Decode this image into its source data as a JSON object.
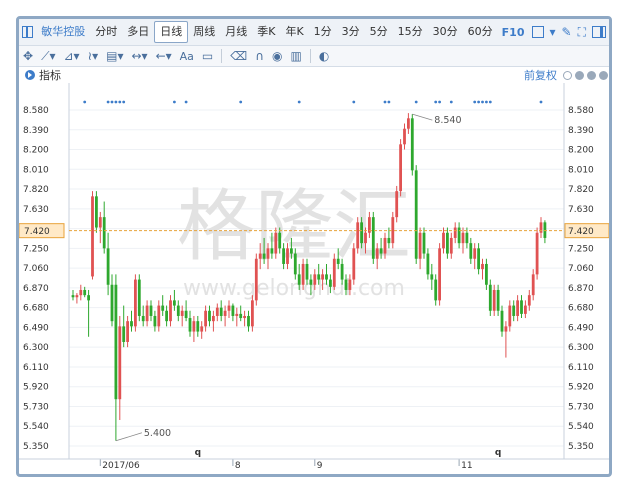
{
  "toolbar": {
    "stock_name": "敏华控股",
    "periods": [
      "分时",
      "多日",
      "日线",
      "周线",
      "月线",
      "季K",
      "年K",
      "1分",
      "3分",
      "5分",
      "15分",
      "30分",
      "60分"
    ],
    "active_period": "日线",
    "f10": "F10"
  },
  "drawbar": {
    "text_tool": "Aa"
  },
  "indicator_bar": {
    "label": "指标",
    "adjust": "前复权"
  },
  "watermark": {
    "cn": "格隆汇",
    "url": "www.gelonghui.com"
  },
  "chart_data": {
    "type": "candlestick",
    "y_ticks": [
      "8.580",
      "8.390",
      "8.200",
      "8.010",
      "7.820",
      "7.630",
      "7.420",
      "7.250",
      "7.060",
      "6.870",
      "6.680",
      "6.490",
      "6.300",
      "6.110",
      "5.920",
      "5.730",
      "5.540",
      "5.350"
    ],
    "ylim": [
      5.35,
      8.58
    ],
    "current_price": "7.420",
    "x_labels": [
      {
        "label": "2017/06",
        "index": 7
      },
      {
        "label": "8",
        "index": 41
      },
      {
        "label": "9",
        "index": 62
      },
      {
        "label": "11",
        "index": 99
      }
    ],
    "annotations": [
      {
        "text": "8.540",
        "index": 87,
        "value": 8.54,
        "kind": "high"
      },
      {
        "text": "5.400",
        "index": 11,
        "value": 5.4,
        "kind": "low"
      }
    ],
    "event_markers": [
      {
        "text": "q",
        "index": 32
      },
      {
        "text": "q",
        "index": 109
      }
    ],
    "dots": [
      3,
      9,
      10,
      11,
      12,
      13,
      26,
      29,
      43,
      58,
      72,
      80,
      81,
      88,
      93,
      94,
      97,
      103,
      104,
      105,
      106,
      107,
      120
    ],
    "colors": {
      "up": "#e05252",
      "down": "#2ea82e",
      "price_line": "#e8a23a"
    },
    "candles": [
      [
        6.8,
        6.85,
        6.75,
        6.78
      ],
      [
        6.78,
        6.82,
        6.72,
        6.8
      ],
      [
        6.8,
        6.9,
        6.75,
        6.85
      ],
      [
        6.85,
        6.88,
        6.78,
        6.8
      ],
      [
        6.8,
        6.85,
        6.4,
        6.75
      ],
      [
        6.98,
        7.8,
        6.95,
        7.75
      ],
      [
        7.75,
        7.8,
        7.4,
        7.45
      ],
      [
        7.45,
        7.6,
        7.3,
        7.55
      ],
      [
        7.55,
        7.7,
        7.2,
        7.25
      ],
      [
        7.25,
        7.4,
        6.8,
        6.9
      ],
      [
        6.9,
        7.0,
        6.5,
        6.55
      ],
      [
        6.9,
        7.0,
        5.4,
        5.8
      ],
      [
        5.8,
        6.6,
        5.6,
        6.5
      ],
      [
        6.5,
        6.7,
        6.3,
        6.35
      ],
      [
        6.35,
        6.6,
        6.3,
        6.55
      ],
      [
        6.55,
        6.65,
        6.45,
        6.5
      ],
      [
        6.5,
        7.0,
        6.45,
        6.95
      ],
      [
        6.95,
        7.0,
        6.55,
        6.6
      ],
      [
        6.6,
        6.7,
        6.5,
        6.55
      ],
      [
        6.55,
        6.75,
        6.5,
        6.7
      ],
      [
        6.7,
        6.75,
        6.55,
        6.6
      ],
      [
        6.6,
        6.65,
        6.45,
        6.5
      ],
      [
        6.5,
        6.75,
        6.45,
        6.7
      ],
      [
        6.7,
        6.8,
        6.6,
        6.65
      ],
      [
        6.65,
        6.7,
        6.5,
        6.55
      ],
      [
        6.55,
        6.8,
        6.5,
        6.75
      ],
      [
        6.75,
        6.85,
        6.65,
        6.7
      ],
      [
        6.7,
        6.75,
        6.55,
        6.6
      ],
      [
        6.6,
        6.7,
        6.5,
        6.65
      ],
      [
        6.65,
        6.75,
        6.55,
        6.58
      ],
      [
        6.58,
        6.65,
        6.4,
        6.45
      ],
      [
        6.45,
        6.6,
        6.35,
        6.55
      ],
      [
        6.55,
        6.6,
        6.4,
        6.45
      ],
      [
        6.45,
        6.55,
        6.38,
        6.5
      ],
      [
        6.5,
        6.7,
        6.45,
        6.65
      ],
      [
        6.65,
        6.7,
        6.5,
        6.55
      ],
      [
        6.55,
        6.65,
        6.45,
        6.6
      ],
      [
        6.6,
        6.72,
        6.55,
        6.68
      ],
      [
        6.68,
        6.75,
        6.55,
        6.6
      ],
      [
        6.6,
        6.7,
        6.5,
        6.65
      ],
      [
        6.65,
        6.75,
        6.58,
        6.7
      ],
      [
        6.7,
        6.72,
        6.55,
        6.6
      ],
      [
        6.6,
        6.68,
        6.5,
        6.62
      ],
      [
        6.62,
        6.7,
        6.55,
        6.58
      ],
      [
        6.58,
        6.65,
        6.5,
        6.6
      ],
      [
        6.6,
        6.65,
        6.45,
        6.5
      ],
      [
        6.5,
        6.8,
        6.45,
        6.75
      ],
      [
        6.75,
        7.2,
        6.7,
        7.15
      ],
      [
        7.15,
        7.3,
        7.05,
        7.2
      ],
      [
        7.2,
        7.35,
        7.1,
        7.15
      ],
      [
        7.15,
        7.3,
        7.05,
        7.25
      ],
      [
        7.25,
        7.4,
        7.15,
        7.2
      ],
      [
        7.2,
        7.45,
        7.15,
        7.4
      ],
      [
        7.4,
        7.45,
        7.2,
        7.25
      ],
      [
        7.25,
        7.3,
        7.05,
        7.1
      ],
      [
        7.1,
        7.3,
        7.05,
        7.25
      ],
      [
        7.25,
        7.35,
        7.15,
        7.2
      ],
      [
        7.2,
        7.25,
        6.95,
        7.0
      ],
      [
        7.0,
        7.1,
        6.85,
        6.9
      ],
      [
        6.9,
        7.15,
        6.85,
        7.1
      ],
      [
        7.1,
        7.15,
        6.9,
        6.95
      ],
      [
        6.95,
        7.0,
        6.8,
        6.9
      ],
      [
        6.9,
        7.05,
        6.85,
        7.0
      ],
      [
        7.0,
        7.1,
        6.9,
        6.95
      ],
      [
        6.95,
        7.05,
        6.85,
        7.0
      ],
      [
        7.0,
        7.1,
        6.9,
        6.95
      ],
      [
        6.95,
        7.0,
        6.82,
        6.88
      ],
      [
        6.88,
        7.2,
        6.85,
        7.15
      ],
      [
        7.15,
        7.25,
        7.05,
        7.1
      ],
      [
        7.1,
        7.15,
        6.9,
        6.95
      ],
      [
        6.95,
        7.0,
        6.8,
        6.85
      ],
      [
        6.85,
        7.0,
        6.8,
        6.95
      ],
      [
        6.95,
        7.3,
        6.9,
        7.25
      ],
      [
        7.25,
        7.55,
        7.2,
        7.5
      ],
      [
        7.5,
        7.55,
        7.25,
        7.3
      ],
      [
        7.3,
        7.45,
        7.2,
        7.4
      ],
      [
        7.4,
        7.6,
        7.35,
        7.55
      ],
      [
        7.55,
        7.6,
        7.1,
        7.15
      ],
      [
        7.15,
        7.3,
        7.05,
        7.25
      ],
      [
        7.25,
        7.35,
        7.15,
        7.2
      ],
      [
        7.2,
        7.4,
        7.15,
        7.35
      ],
      [
        7.35,
        7.45,
        7.25,
        7.3
      ],
      [
        7.3,
        7.6,
        7.25,
        7.55
      ],
      [
        7.55,
        7.85,
        7.5,
        7.8
      ],
      [
        7.8,
        8.3,
        7.75,
        8.25
      ],
      [
        8.25,
        8.45,
        8.2,
        8.4
      ],
      [
        8.4,
        8.55,
        8.35,
        8.5
      ],
      [
        8.5,
        8.54,
        7.95,
        8.0
      ],
      [
        8.0,
        8.05,
        7.1,
        7.15
      ],
      [
        7.15,
        7.45,
        7.05,
        7.4
      ],
      [
        7.4,
        7.45,
        7.15,
        7.2
      ],
      [
        7.2,
        7.25,
        6.95,
        7.0
      ],
      [
        7.0,
        7.1,
        6.85,
        6.95
      ],
      [
        6.95,
        7.0,
        6.7,
        6.75
      ],
      [
        6.75,
        7.3,
        6.7,
        7.25
      ],
      [
        7.25,
        7.45,
        7.2,
        7.4
      ],
      [
        7.4,
        7.45,
        7.15,
        7.2
      ],
      [
        7.2,
        7.4,
        7.15,
        7.35
      ],
      [
        7.35,
        7.5,
        7.3,
        7.45
      ],
      [
        7.45,
        7.5,
        7.25,
        7.3
      ],
      [
        7.3,
        7.45,
        7.2,
        7.4
      ],
      [
        7.4,
        7.45,
        7.25,
        7.3
      ],
      [
        7.3,
        7.35,
        7.1,
        7.15
      ],
      [
        7.15,
        7.3,
        7.05,
        7.25
      ],
      [
        7.25,
        7.3,
        7.0,
        7.05
      ],
      [
        7.05,
        7.15,
        6.95,
        7.1
      ],
      [
        7.1,
        7.15,
        6.85,
        6.9
      ],
      [
        6.9,
        6.95,
        6.6,
        6.65
      ],
      [
        6.65,
        6.9,
        6.6,
        6.85
      ],
      [
        6.85,
        6.9,
        6.6,
        6.65
      ],
      [
        6.65,
        6.7,
        6.4,
        6.45
      ],
      [
        6.45,
        6.55,
        6.2,
        6.5
      ],
      [
        6.5,
        6.75,
        6.45,
        6.7
      ],
      [
        6.7,
        6.75,
        6.55,
        6.6
      ],
      [
        6.6,
        6.8,
        6.55,
        6.75
      ],
      [
        6.75,
        6.8,
        6.58,
        6.62
      ],
      [
        6.62,
        6.75,
        6.58,
        6.7
      ],
      [
        6.7,
        6.85,
        6.65,
        6.8
      ],
      [
        6.8,
        7.05,
        6.75,
        7.0
      ],
      [
        7.0,
        7.45,
        6.95,
        7.4
      ],
      [
        7.4,
        7.55,
        7.35,
        7.5
      ],
      [
        7.5,
        7.52,
        7.3,
        7.35
      ]
    ]
  }
}
